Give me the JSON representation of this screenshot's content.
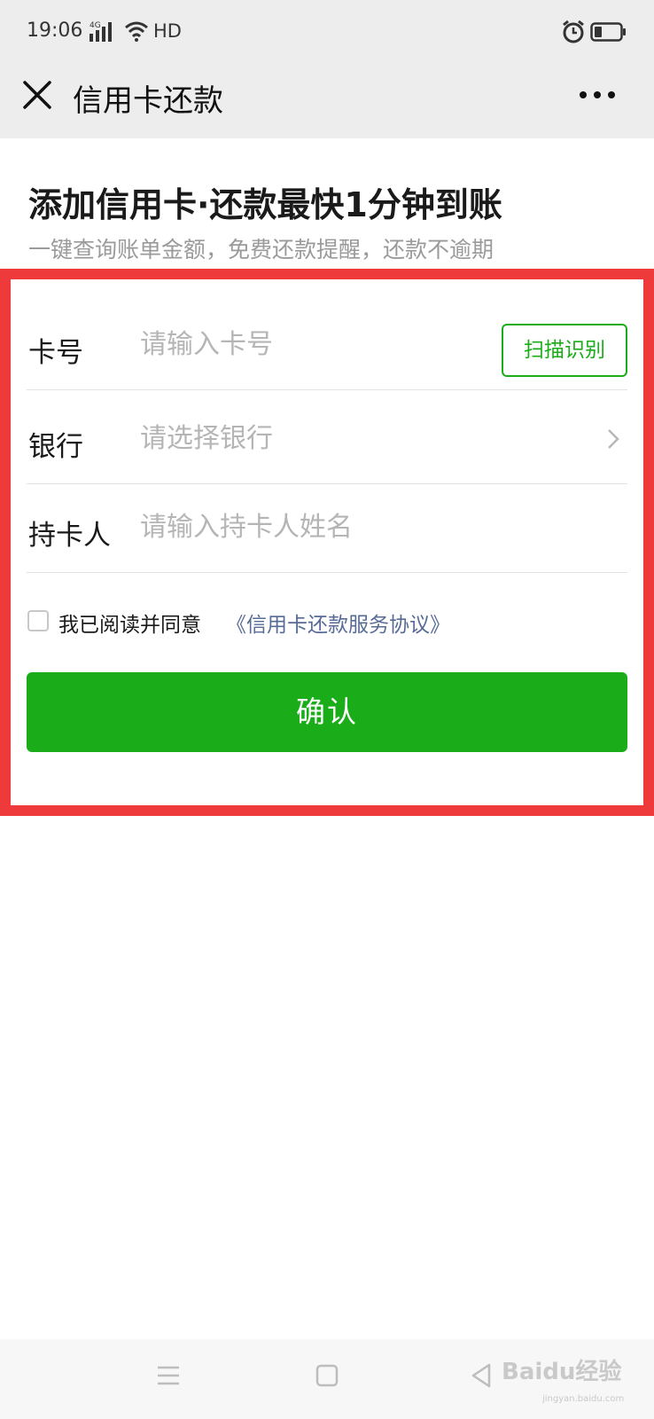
{
  "status_bar": {
    "time": "19:06",
    "network": "4G",
    "hd": "HD",
    "icons": [
      "signal-icon",
      "wifi-icon",
      "alarm-icon",
      "battery-icon"
    ]
  },
  "title_bar": {
    "title": "信用卡还款",
    "icons": [
      "close-icon",
      "more-icon"
    ]
  },
  "header": {
    "headline": "添加信用卡·还款最快1分钟到账",
    "subline": "一键查询账单金额，免费还款提醒，还款不逾期"
  },
  "form": {
    "card_number": {
      "label": "卡号",
      "placeholder": "请输入卡号",
      "value": "",
      "scan_label": "扫描识别"
    },
    "bank": {
      "label": "银行",
      "placeholder": "请选择银行",
      "value": ""
    },
    "holder": {
      "label": "持卡人",
      "placeholder": "请输入持卡人姓名",
      "value": ""
    }
  },
  "agreement": {
    "text": "我已阅读并同意",
    "link": "《信用卡还款服务协议》",
    "checked": false
  },
  "confirm_label": "确认",
  "bottom_nav": {
    "icons": [
      "menu-icon",
      "home-icon",
      "back-icon"
    ],
    "watermark": "Baidu经验",
    "watermark_sub": "jingyan.baidu.com"
  },
  "colors": {
    "accent": "#1aad19",
    "link": "#576b95",
    "highlight_frame": "#ee3a3a",
    "title_bar_bg": "#ededed"
  }
}
